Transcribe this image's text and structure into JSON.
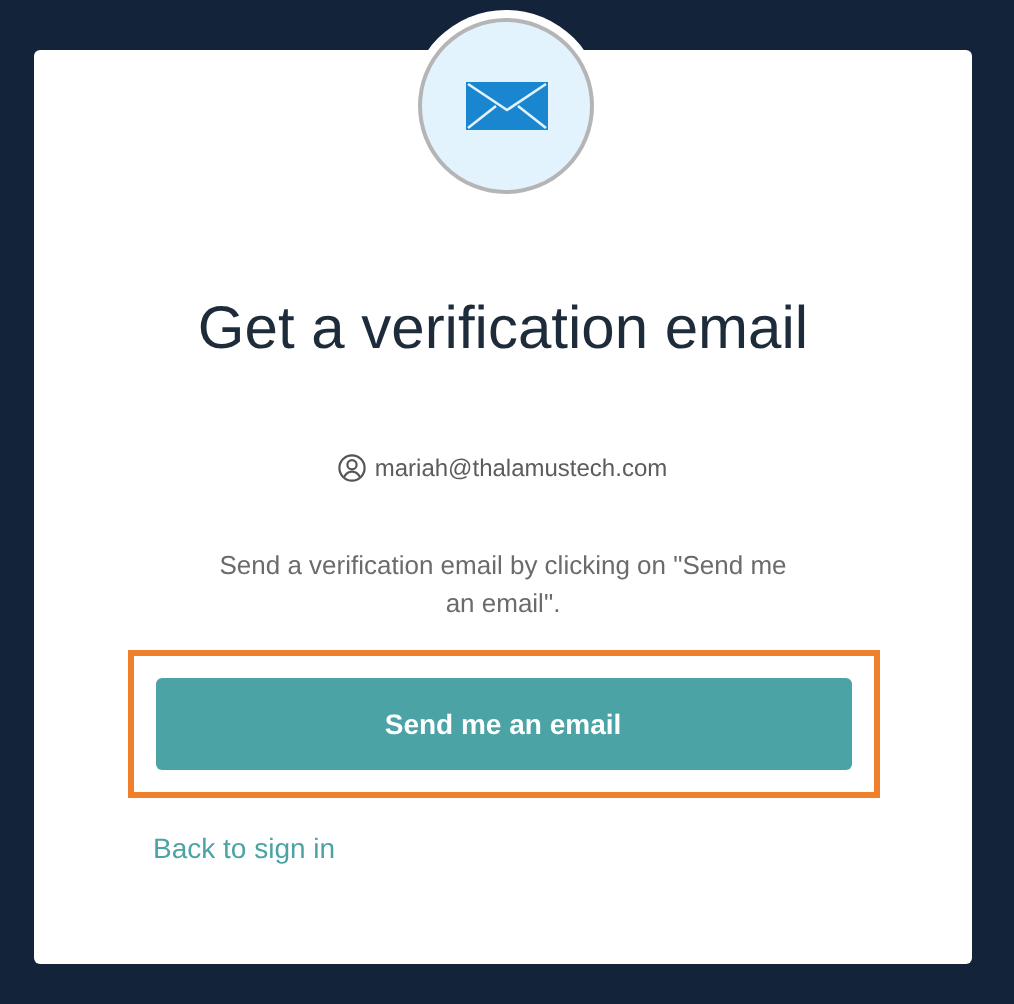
{
  "title": "Get a verification email",
  "account": {
    "email": "mariah@thalamustech.com"
  },
  "instructions": "Send a verification email by clicking on \"Send me an email\".",
  "button": {
    "label": "Send me an email",
    "highlighted": true
  },
  "link": "Back to sign in"
}
